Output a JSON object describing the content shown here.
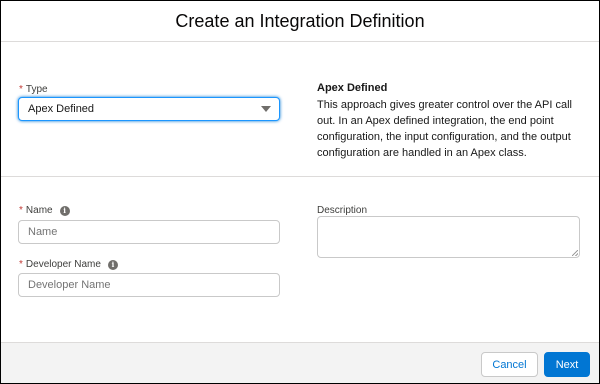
{
  "modal": {
    "title": "Create an Integration Definition"
  },
  "type_section": {
    "label": "Type",
    "required_marker": "*",
    "selected_value": "Apex Defined",
    "info_title": "Apex Defined",
    "info_text": "This approach gives greater control over the API call out. In an Apex defined integration, the end point configuration, the input configuration, and the output configuration are handled in an Apex class."
  },
  "fields": {
    "name": {
      "label": "Name",
      "placeholder": "Name",
      "required_marker": "*",
      "info_icon": "info-icon"
    },
    "developer_name": {
      "label": "Developer Name",
      "placeholder": "Developer Name",
      "required_marker": "*",
      "info_icon": "info-icon"
    },
    "description": {
      "label": "Description"
    }
  },
  "footer": {
    "cancel_label": "Cancel",
    "next_label": "Next"
  },
  "colors": {
    "brand": "#0176d3",
    "required": "#c23934",
    "focus_border": "#1b96ff",
    "footer_bg": "#f3f3f3"
  }
}
